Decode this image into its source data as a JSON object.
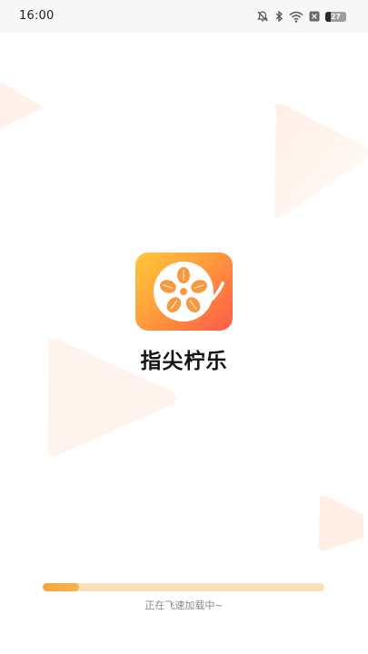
{
  "status_bar": {
    "time": "16:00",
    "battery_level": "27",
    "icons": [
      "mute-icon",
      "bluetooth-icon",
      "wifi-icon",
      "sim-x-icon",
      "battery-icon"
    ]
  },
  "app": {
    "name": "指尖柠乐",
    "logo_icon": "film-reel-icon",
    "accent_colors": [
      "#ffc93a",
      "#ff9c3b",
      "#ff5a4a"
    ]
  },
  "loading": {
    "text": "正在飞速加载中~",
    "progress_fraction": 0.13,
    "track_color": "#fbdfb8",
    "fill_color": "#f8a23a"
  }
}
